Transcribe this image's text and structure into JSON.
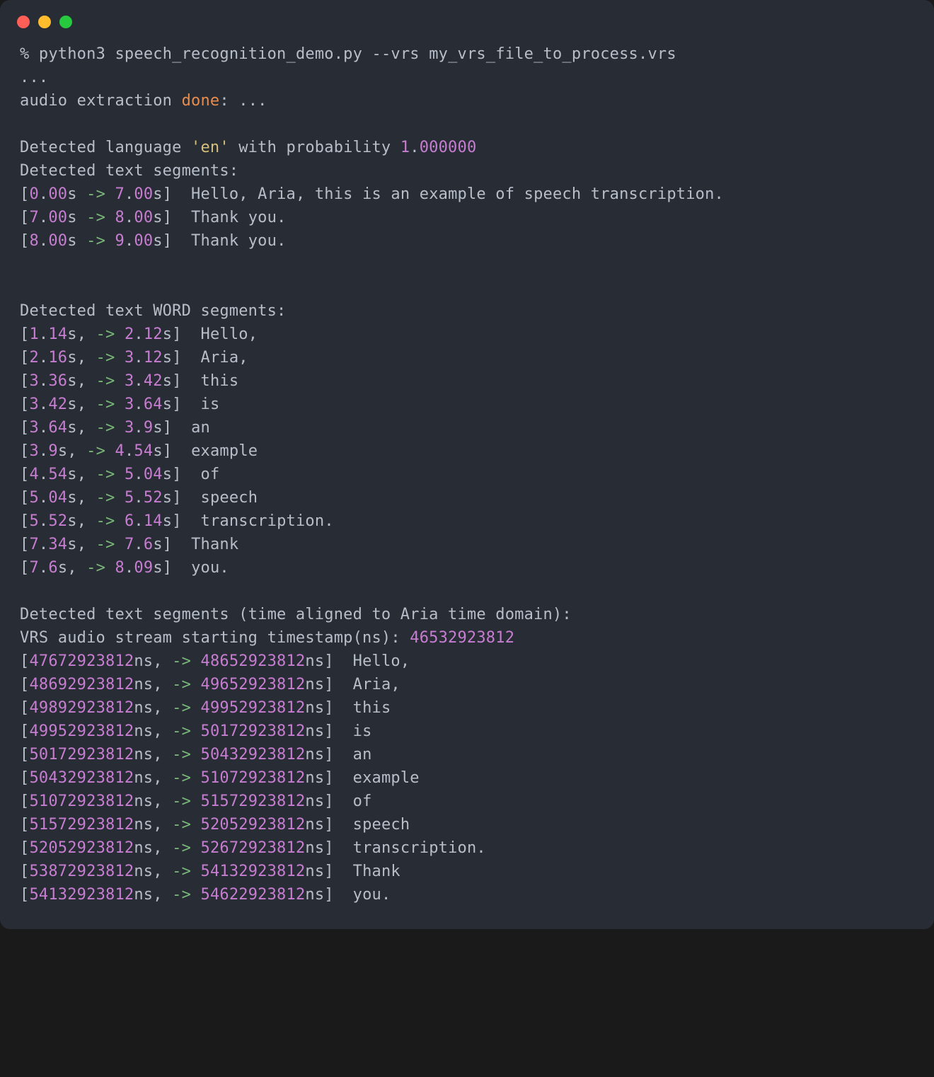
{
  "command": {
    "prompt": "%",
    "exe": "python3",
    "script": "speech_recognition_demo.py",
    "flag": "--vrs",
    "arg": "my_vrs_file_to_process.vrs"
  },
  "ellipsis": "...",
  "extraction": {
    "prefix": "audio extraction ",
    "done": "done",
    "suffix": ": ..."
  },
  "lang": {
    "prefix": "Detected language ",
    "value": "'en'",
    "mid": " with probability ",
    "num1": "1",
    "dot": ".",
    "num2": "000000"
  },
  "segHeader": "Detected text segments:",
  "segments": [
    {
      "a1": "0",
      "a2": "00",
      "b1": "7",
      "b2": "00",
      "text": "Hello, Aria, this is an example of speech transcription."
    },
    {
      "a1": "7",
      "a2": "00",
      "b1": "8",
      "b2": "00",
      "text": "Thank you."
    },
    {
      "a1": "8",
      "a2": "00",
      "b1": "9",
      "b2": "00",
      "text": "Thank you."
    }
  ],
  "wordHeader": "Detected text WORD segments:",
  "words": [
    {
      "a1": "1",
      "a2": "14",
      "b1": "2",
      "b2": "12",
      "text": "Hello,"
    },
    {
      "a1": "2",
      "a2": "16",
      "b1": "3",
      "b2": "12",
      "text": "Aria,"
    },
    {
      "a1": "3",
      "a2": "36",
      "b1": "3",
      "b2": "42",
      "text": "this"
    },
    {
      "a1": "3",
      "a2": "42",
      "b1": "3",
      "b2": "64",
      "text": "is"
    },
    {
      "a1": "3",
      "a2": "64",
      "b1": "3",
      "b2": "9",
      "text": "an"
    },
    {
      "a1": "3",
      "a2": "9",
      "b1": "4",
      "b2": "54",
      "text": "example"
    },
    {
      "a1": "4",
      "a2": "54",
      "b1": "5",
      "b2": "04",
      "text": "of"
    },
    {
      "a1": "5",
      "a2": "04",
      "b1": "5",
      "b2": "52",
      "text": "speech"
    },
    {
      "a1": "5",
      "a2": "52",
      "b1": "6",
      "b2": "14",
      "text": "transcription."
    },
    {
      "a1": "7",
      "a2": "34",
      "b1": "7",
      "b2": "6",
      "text": "Thank"
    },
    {
      "a1": "7",
      "a2": "6",
      "b1": "8",
      "b2": "09",
      "text": "you."
    }
  ],
  "alignedHeader": "Detected text segments (time aligned to Aria time domain):",
  "vrsTs": {
    "prefix": "VRS audio stream starting timestamp(ns): ",
    "value": "46532923812"
  },
  "aligned": [
    {
      "a": "47672923812",
      "b": "48652923812",
      "text": "Hello,"
    },
    {
      "a": "48692923812",
      "b": "49652923812",
      "text": "Aria,"
    },
    {
      "a": "49892923812",
      "b": "49952923812",
      "text": "this"
    },
    {
      "a": "49952923812",
      "b": "50172923812",
      "text": "is"
    },
    {
      "a": "50172923812",
      "b": "50432923812",
      "text": "an"
    },
    {
      "a": "50432923812",
      "b": "51072923812",
      "text": "example"
    },
    {
      "a": "51072923812",
      "b": "51572923812",
      "text": "of"
    },
    {
      "a": "51572923812",
      "b": "52052923812",
      "text": "speech"
    },
    {
      "a": "52052923812",
      "b": "52672923812",
      "text": "transcription."
    },
    {
      "a": "53872923812",
      "b": "54132923812",
      "text": "Thank"
    },
    {
      "a": "54132923812",
      "b": "54622923812",
      "text": "you."
    }
  ]
}
